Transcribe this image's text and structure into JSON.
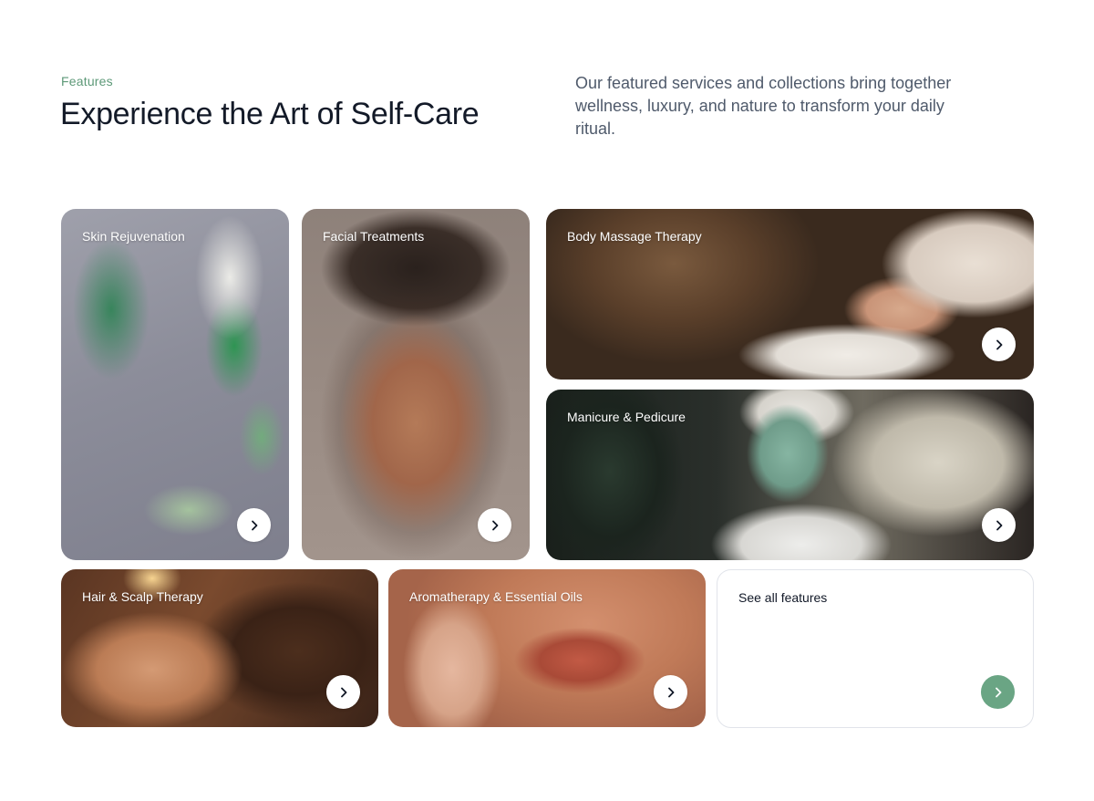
{
  "header": {
    "eyebrow": "Features",
    "title": "Experience the Art of Self-Care",
    "intro": "Our featured services and collections bring together wellness, luxury, and nature to transform your daily ritual."
  },
  "cards": [
    {
      "label": "Skin Rejuvenation"
    },
    {
      "label": "Facial Treatments"
    },
    {
      "label": "Body Massage Therapy"
    },
    {
      "label": "Manicure & Pedicure"
    },
    {
      "label": "Hair & Scalp Therapy"
    },
    {
      "label": "Aromatherapy & Essential Oils"
    },
    {
      "label": "See all features"
    }
  ],
  "icons": {
    "arrow": "chevron-right-icon"
  },
  "colors": {
    "accent": "#5d9978",
    "accent_button": "#6aa584",
    "title": "#131a28",
    "body_text": "#4f5a6b"
  }
}
